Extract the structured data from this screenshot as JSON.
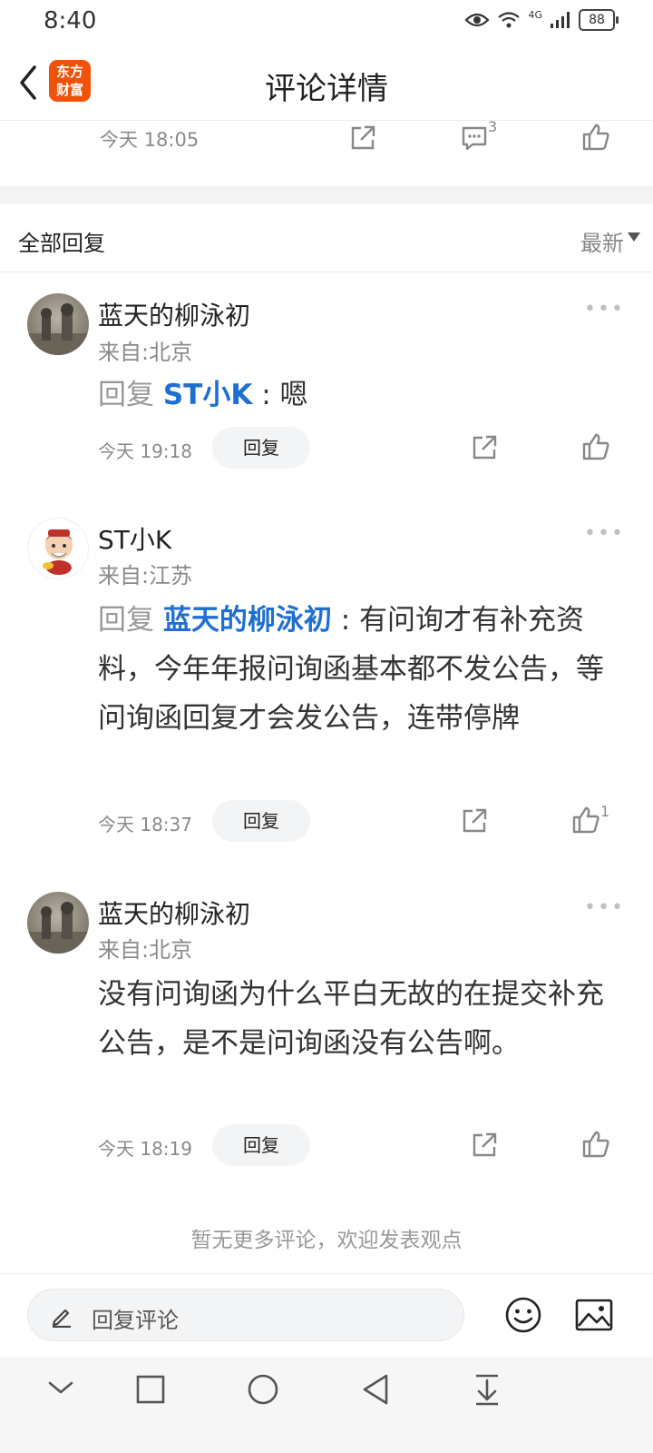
{
  "status": {
    "time": "8:40",
    "network": "4G",
    "battery": "88"
  },
  "header": {
    "title": "评论详情",
    "logo_line1": "东方",
    "logo_line2": "财富"
  },
  "top_comment": {
    "time": "今天 18:05",
    "comment_count": "3"
  },
  "replies_section": {
    "title": "全部回复",
    "sort": "最新"
  },
  "replies": [
    {
      "username": "蓝天的柳泳初",
      "location": "来自:北京",
      "reply_prefix": "回复 ",
      "mention": "ST小K",
      "separator": " : ",
      "text": "嗯",
      "time": "今天 19:18",
      "reply_label": "回复",
      "likes": ""
    },
    {
      "username": "ST小K",
      "location": "来自:江苏",
      "reply_prefix": "回复 ",
      "mention": "蓝天的柳泳初",
      "separator": " : ",
      "text": "有问询才有补充资料，今年年报问询函基本都不发公告，等问询函回复才会发公告，连带停牌",
      "time": "今天 18:37",
      "reply_label": "回复",
      "likes": "1"
    },
    {
      "username": "蓝天的柳泳初",
      "location": "来自:北京",
      "text": "没有问询函为什么平白无故的在提交补充公告，是不是问询函没有公告啊。",
      "time": "今天 18:19",
      "reply_label": "回复",
      "likes": ""
    }
  ],
  "footer": {
    "no_more": "暂无更多评论，欢迎发表观点"
  },
  "input": {
    "placeholder": "回复评论"
  },
  "icons": {
    "back": "back-arrow-icon",
    "share": "share-icon",
    "comment": "comment-icon",
    "like": "thumbs-up-icon",
    "more": "more-icon",
    "edit": "pencil-icon",
    "emoji": "emoji-icon",
    "image": "image-icon"
  },
  "colors": {
    "brand": "#f0520a",
    "mention": "#1f6fd1"
  }
}
